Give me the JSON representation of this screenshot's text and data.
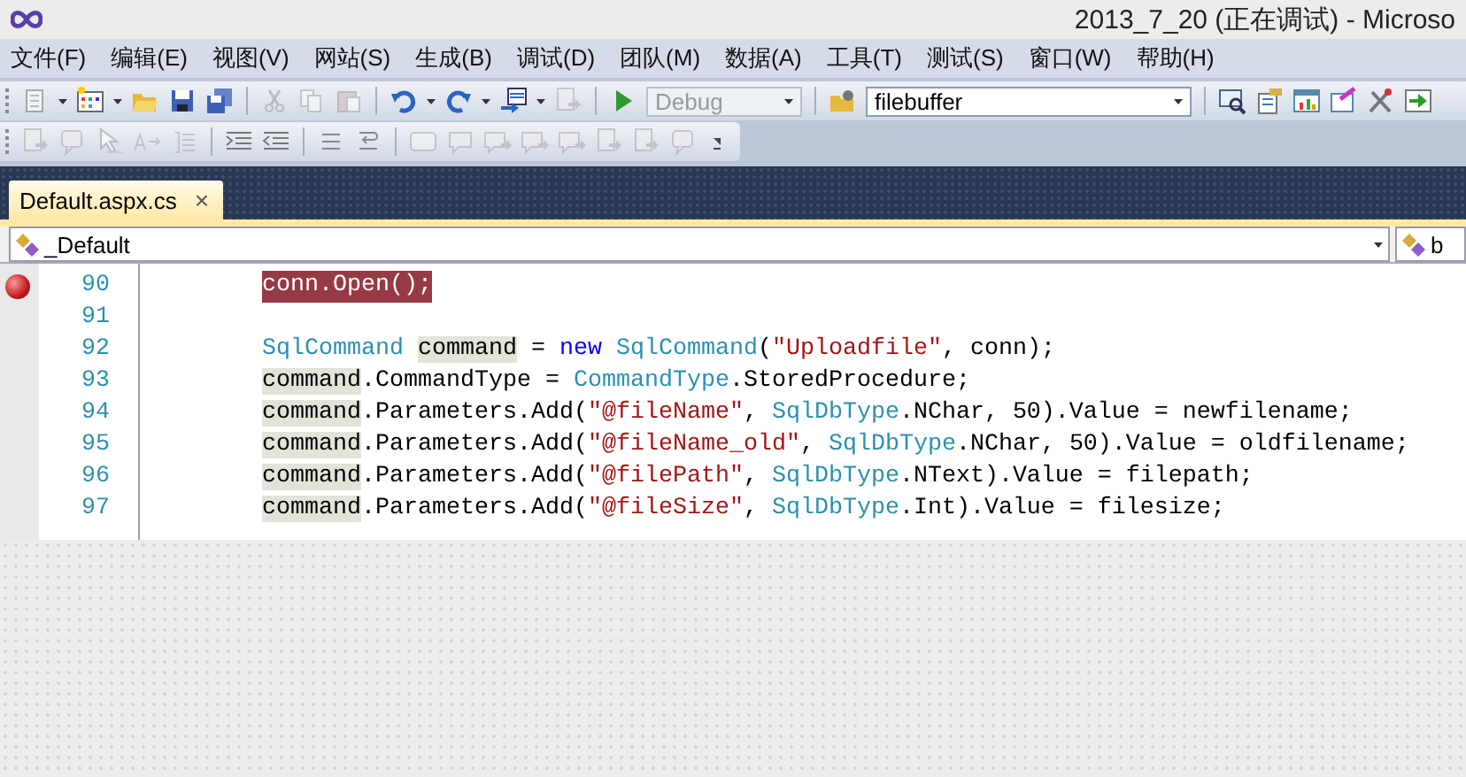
{
  "window": {
    "title": "2013_7_20 (正在调试) - Microso"
  },
  "menu": [
    "文件(F)",
    "编辑(E)",
    "视图(V)",
    "网站(S)",
    "生成(B)",
    "调试(D)",
    "团队(M)",
    "数据(A)",
    "工具(T)",
    "测试(S)",
    "窗口(W)",
    "帮助(H)"
  ],
  "toolbar": {
    "configuration": {
      "value": "Debug",
      "disabled": true
    },
    "find": {
      "value": "filebuffer",
      "disabled": false
    }
  },
  "tabs": [
    {
      "label": "Default.aspx.cs",
      "selected": true,
      "close": "×"
    }
  ],
  "navigation": {
    "type_box": "_Default",
    "member_box": "b"
  },
  "editor": {
    "lines": [
      {
        "number": "90",
        "breakpoint": true,
        "changed": false,
        "tokens": [
          {
            "text": "conn.Open();",
            "kind": "plain"
          }
        ]
      },
      {
        "number": "91",
        "breakpoint": false,
        "changed": false
      },
      {
        "number": "92",
        "breakpoint": false,
        "changed": false,
        "tokens": [
          {
            "text": "SqlCommand ",
            "kind": "type"
          },
          {
            "text": "command",
            "kind": "reference"
          },
          {
            "text": " = ",
            "kind": "plain"
          },
          {
            "text": "new ",
            "kind": "keyword"
          },
          {
            "text": "SqlCommand",
            "kind": "type"
          },
          {
            "text": "(",
            "kind": "plain"
          },
          {
            "text": "\"Uploadfile\"",
            "kind": "string"
          },
          {
            "text": ", conn);",
            "kind": "plain"
          }
        ]
      },
      {
        "number": "93",
        "breakpoint": false,
        "changed": false,
        "tokens": [
          {
            "text": "command",
            "kind": "reference"
          },
          {
            "text": ".CommandType = ",
            "kind": "plain"
          },
          {
            "text": "CommandType",
            "kind": "type"
          },
          {
            "text": ".StoredProcedure;",
            "kind": "plain"
          }
        ]
      },
      {
        "number": "94",
        "breakpoint": false,
        "changed": false,
        "tokens": [
          {
            "text": "command",
            "kind": "reference"
          },
          {
            "text": ".Parameters.Add(",
            "kind": "plain"
          },
          {
            "text": "\"@fileName\"",
            "kind": "string"
          },
          {
            "text": ", ",
            "kind": "plain"
          },
          {
            "text": "SqlDbType",
            "kind": "type"
          },
          {
            "text": ".NChar, 50).Value = newfilename;",
            "kind": "plain"
          }
        ]
      },
      {
        "number": "95",
        "breakpoint": false,
        "changed": false,
        "tokens": [
          {
            "text": "command",
            "kind": "reference"
          },
          {
            "text": ".Parameters.Add(",
            "kind": "plain"
          },
          {
            "text": "\"@fileName_old\"",
            "kind": "string"
          },
          {
            "text": ", ",
            "kind": "plain"
          },
          {
            "text": "SqlDbType",
            "kind": "type"
          },
          {
            "text": ".NChar, 50).Value = oldfilename;",
            "kind": "plain"
          }
        ]
      },
      {
        "number": "96",
        "breakpoint": false,
        "changed": false,
        "tokens": [
          {
            "text": "command",
            "kind": "reference"
          },
          {
            "text": ".Parameters.Add(",
            "kind": "plain"
          },
          {
            "text": "\"@filePath\"",
            "kind": "string"
          },
          {
            "text": ", ",
            "kind": "plain"
          },
          {
            "text": "SqlDbType",
            "kind": "type"
          },
          {
            "text": ".NText).Value = filepath;",
            "kind": "plain"
          }
        ]
      },
      {
        "number": "97",
        "breakpoint": false,
        "changed": false,
        "tokens": [
          {
            "text": "command",
            "kind": "reference"
          },
          {
            "text": ".Parameters.Add(",
            "kind": "plain"
          },
          {
            "text": "\"@fileSize\"",
            "kind": "string"
          },
          {
            "text": ", ",
            "kind": "plain"
          },
          {
            "text": "SqlDbType",
            "kind": "type"
          },
          {
            "text": ".Int).Value = filesize;",
            "kind": "plain"
          }
        ]
      }
    ]
  }
}
